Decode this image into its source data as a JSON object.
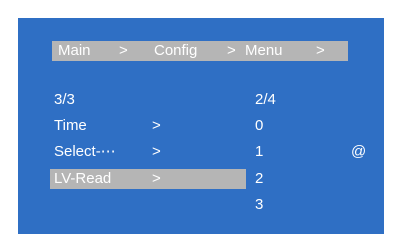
{
  "breadcrumb": {
    "main": "Main",
    "sep1": ">",
    "config": "Config",
    "sep2": ">",
    "menu": "Menu",
    "sep3": ">"
  },
  "page_indicator": "3/3",
  "value_page_indicator": "2/4",
  "menu_items": [
    {
      "label": "Time",
      "arrow": ">"
    },
    {
      "label": "Select-⋯",
      "arrow": ">"
    },
    {
      "label": "LV-Read",
      "arrow": ">"
    }
  ],
  "values": [
    "0",
    "1",
    "2",
    "3"
  ],
  "cursor_symbol": "@",
  "colors": {
    "background": "#2f6fc4",
    "highlight": "#b5b5b5",
    "text": "#ffffff"
  }
}
